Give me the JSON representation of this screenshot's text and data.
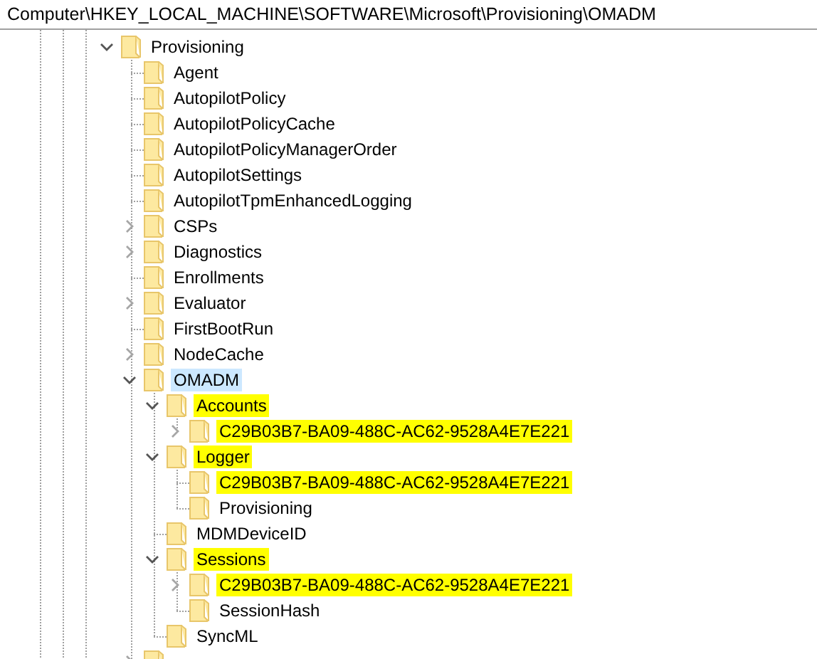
{
  "address_bar": {
    "path": "Computer\\HKEY_LOCAL_MACHINE\\SOFTWARE\\Microsoft\\Provisioning\\OMADM"
  },
  "tree": [
    {
      "label": "Provisioning",
      "kind": "branch",
      "expanded": true,
      "selected": false,
      "highlighted": false,
      "children": [
        {
          "label": "Agent",
          "kind": "leaf",
          "selected": false,
          "highlighted": false
        },
        {
          "label": "AutopilotPolicy",
          "kind": "leaf",
          "selected": false,
          "highlighted": false
        },
        {
          "label": "AutopilotPolicyCache",
          "kind": "leaf",
          "selected": false,
          "highlighted": false
        },
        {
          "label": "AutopilotPolicyManagerOrder",
          "kind": "leaf",
          "selected": false,
          "highlighted": false
        },
        {
          "label": "AutopilotSettings",
          "kind": "leaf",
          "selected": false,
          "highlighted": false
        },
        {
          "label": "AutopilotTpmEnhancedLogging",
          "kind": "leaf",
          "selected": false,
          "highlighted": false
        },
        {
          "label": "CSPs",
          "kind": "branch",
          "expanded": false,
          "selected": false,
          "highlighted": false
        },
        {
          "label": "Diagnostics",
          "kind": "branch",
          "expanded": false,
          "selected": false,
          "highlighted": false
        },
        {
          "label": "Enrollments",
          "kind": "leaf",
          "selected": false,
          "highlighted": false
        },
        {
          "label": "Evaluator",
          "kind": "branch",
          "expanded": false,
          "selected": false,
          "highlighted": false
        },
        {
          "label": "FirstBootRun",
          "kind": "leaf",
          "selected": false,
          "highlighted": false
        },
        {
          "label": "NodeCache",
          "kind": "branch",
          "expanded": false,
          "selected": false,
          "highlighted": false
        },
        {
          "label": "OMADM",
          "kind": "branch",
          "expanded": true,
          "selected": true,
          "highlighted": false,
          "children": [
            {
              "label": "Accounts",
              "kind": "branch",
              "expanded": true,
              "selected": false,
              "highlighted": true,
              "children": [
                {
                  "label": "C29B03B7-BA09-488C-AC62-9528A4E7E221",
                  "kind": "branch",
                  "expanded": false,
                  "selected": false,
                  "highlighted": true
                }
              ]
            },
            {
              "label": "Logger",
              "kind": "branch",
              "expanded": true,
              "selected": false,
              "highlighted": true,
              "children": [
                {
                  "label": "C29B03B7-BA09-488C-AC62-9528A4E7E221",
                  "kind": "leaf",
                  "selected": false,
                  "highlighted": true
                },
                {
                  "label": "Provisioning",
                  "kind": "leaf",
                  "selected": false,
                  "highlighted": false
                }
              ]
            },
            {
              "label": "MDMDeviceID",
              "kind": "leaf",
              "selected": false,
              "highlighted": false
            },
            {
              "label": "Sessions",
              "kind": "branch",
              "expanded": true,
              "selected": false,
              "highlighted": true,
              "children": [
                {
                  "label": "C29B03B7-BA09-488C-AC62-9528A4E7E221",
                  "kind": "branch",
                  "expanded": false,
                  "selected": false,
                  "highlighted": true
                },
                {
                  "label": "SessionHash",
                  "kind": "leaf",
                  "selected": false,
                  "highlighted": false
                }
              ]
            },
            {
              "label": "SyncML",
              "kind": "leaf",
              "selected": false,
              "highlighted": false
            }
          ]
        },
        {
          "kind": "branch",
          "expanded": false
        }
      ]
    }
  ]
}
